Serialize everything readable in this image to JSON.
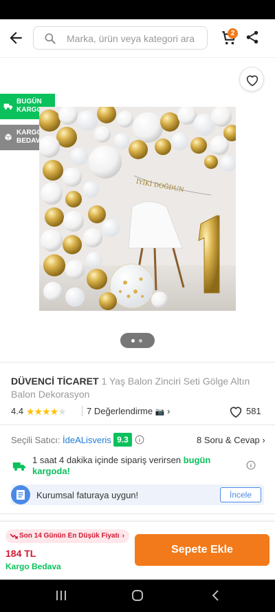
{
  "search": {
    "placeholder": "Marka, ürün veya kategori ara"
  },
  "cart": {
    "count": "2"
  },
  "tags": {
    "fast_line1": "BUGÜN",
    "fast_line2": "KARGODA",
    "free_line1": "KARGO",
    "free_line2": "BEDAVA"
  },
  "product": {
    "brand": "DÜVENCİ TİCARET",
    "name": "1 Yaş Balon Zinciri Seti Gölge Altın Balon Dekorasyon",
    "rating": "4.4",
    "reviews": "7 Değerlendirme",
    "likes": "581",
    "photo_banner": "İYİKİ DOĞDUN"
  },
  "seller": {
    "label": "Seçili Satıcı:",
    "name": "İdeALisveris",
    "score": "9.3",
    "qa": "8 Soru & Cevap"
  },
  "delivery": {
    "part1": "1 saat 4 dakika içinde",
    "part2": " sipariş verirsen ",
    "part3": "bugün kargoda!"
  },
  "invoice": {
    "text": "Kurumsal faturaya uygun!",
    "button": "İncele"
  },
  "bottom": {
    "lowest": "Son 14 Günün En Düşük Fiyatı",
    "price": "184 TL",
    "cargo": "Kargo Bedava",
    "add": "Sepete Ekle"
  },
  "colors": {
    "brand": "#f27a1a",
    "green": "#0bc15c",
    "red": "#d21a35",
    "blue": "#1d7bd4"
  },
  "icons": [
    "back-arrow-icon",
    "search-icon",
    "cart-icon",
    "share-icon",
    "heart-icon",
    "truck-icon",
    "box-icon",
    "info-icon",
    "document-icon",
    "trend-down-icon"
  ]
}
